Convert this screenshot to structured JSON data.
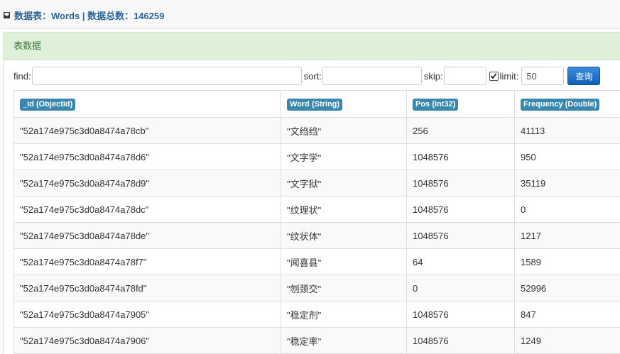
{
  "header": {
    "title": "数据表：Words | 数据总数：146259",
    "icon": "inbox-icon"
  },
  "panel": {
    "heading": "表数据"
  },
  "filters": {
    "find_label": "find:",
    "find_value": "",
    "sort_label": "sort:",
    "sort_value": "",
    "skip_label": "skip:",
    "skip_value": "",
    "limit_checked": true,
    "limit_label": "limit:",
    "limit_value": "50",
    "query_button": "查询"
  },
  "table": {
    "columns": [
      "_id (ObjectId)",
      "Word (String)",
      "Pos (Int32)",
      "Frequency (Double)"
    ],
    "rows": [
      [
        "\"52a174e975c3d0a8474a78cb\"",
        "\"文绉绉\"",
        "256",
        "41113"
      ],
      [
        "\"52a174e975c3d0a8474a78d6\"",
        "\"文字学\"",
        "1048576",
        "950"
      ],
      [
        "\"52a174e975c3d0a8474a78d9\"",
        "\"文字狱\"",
        "1048576",
        "35119"
      ],
      [
        "\"52a174e975c3d0a8474a78dc\"",
        "\"纹理状\"",
        "1048576",
        "0"
      ],
      [
        "\"52a174e975c3d0a8474a78de\"",
        "\"纹状体\"",
        "1048576",
        "1217"
      ],
      [
        "\"52a174e975c3d0a8474a78f7\"",
        "\"闻喜县\"",
        "64",
        "1589"
      ],
      [
        "\"52a174e975c3d0a8474a78fd\"",
        "\"刎颈交\"",
        "0",
        "52996"
      ],
      [
        "\"52a174e975c3d0a8474a7905\"",
        "\"稳定剂\"",
        "1048576",
        "847"
      ],
      [
        "\"52a174e975c3d0a8474a7906\"",
        "\"稳定率\"",
        "1048576",
        "1249"
      ]
    ]
  },
  "colors": {
    "accent": "#3a87ad",
    "panel_heading_bg": "#dff0d8",
    "button": "#1a6fc9"
  }
}
